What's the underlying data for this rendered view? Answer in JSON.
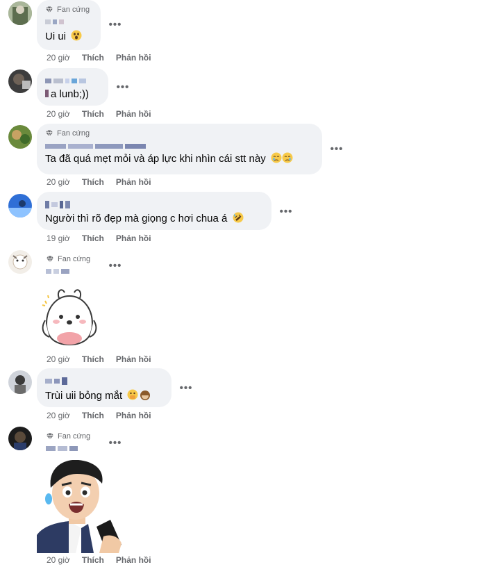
{
  "labels": {
    "fan_badge": "Fan cứng",
    "like": "Thích",
    "reply": "Phản hồi",
    "more": "•••"
  },
  "comments": [
    {
      "text": "Ui ui",
      "time": "20 giờ"
    },
    {
      "text": "a lunb;))",
      "time": "20 giờ"
    },
    {
      "text": "Ta đã quá mẹt mỏi và áp lực khi nhìn cái stt này",
      "time": "20 giờ"
    },
    {
      "text": "Người thì rõ đẹp mà giọng c hơi chua á",
      "time": "19 giờ"
    },
    {
      "text": "",
      "time": "20 giờ"
    },
    {
      "text": "Trùi uii bỏng mắt",
      "time": "20 giờ"
    },
    {
      "text": "",
      "time": "20 giờ"
    }
  ],
  "colors": {
    "bubble": "#f0f2f5",
    "meta": "#65676b",
    "text": "#050505"
  }
}
